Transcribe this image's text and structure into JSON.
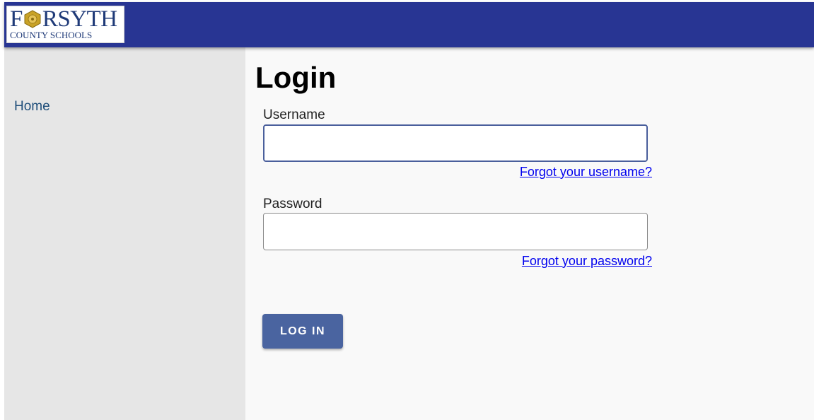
{
  "header": {
    "logo_line1_pre": "F",
    "logo_line1_post": "RSYTH",
    "logo_line2": "COUNTY SCHOOLS",
    "seal_icon": "seal-emblem-icon",
    "colors": {
      "bar": "#283593",
      "logo_text": "#1f3a78",
      "seal": "#c9a227"
    }
  },
  "sidebar": {
    "items": [
      {
        "label": "Home"
      }
    ]
  },
  "main": {
    "title": "Login",
    "username": {
      "label": "Username",
      "value": "",
      "placeholder": "",
      "forgot_link": "Forgot your username?"
    },
    "password": {
      "label": "Password",
      "value": "",
      "placeholder": "",
      "forgot_link": "Forgot your password?"
    },
    "submit_label": "LOG IN",
    "colors": {
      "button": "#4a64a0",
      "link": "#0000ee"
    }
  }
}
